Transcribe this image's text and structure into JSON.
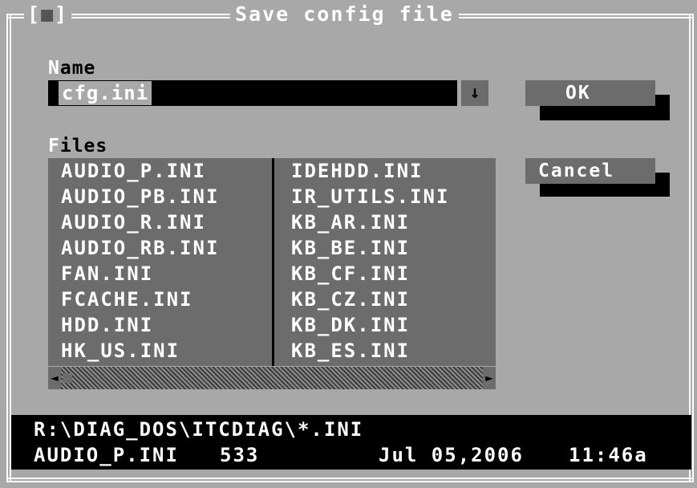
{
  "window": {
    "title": "Save config file",
    "close_glyph_left": "[",
    "close_glyph_mark": "■",
    "close_glyph_right": "]"
  },
  "name_field": {
    "label_hot": "N",
    "label_rest": "ame",
    "value": "cfg.ini",
    "history_glyph": "↓"
  },
  "files": {
    "label_hot": "F",
    "label_rest": "iles",
    "column_1": [
      "AUDIO_P.INI",
      "AUDIO_PB.INI",
      "AUDIO_R.INI",
      "AUDIO_RB.INI",
      "FAN.INI",
      "FCACHE.INI",
      "HDD.INI",
      "HK_US.INI"
    ],
    "column_2": [
      "IDEHDD.INI",
      "IR_UTILS.INI",
      "KB_AR.INI",
      "KB_BE.INI",
      "KB_CF.INI",
      "KB_CZ.INI",
      "KB_DK.INI",
      "KB_ES.INI"
    ],
    "scroll_left_glyph": "◄",
    "scroll_right_glyph": "►"
  },
  "buttons": {
    "ok": "OK",
    "cancel": "Cancel"
  },
  "info": {
    "path": "R:\\DIAG_DOS\\ITCDIAG\\*.INI",
    "file_name": "AUDIO_P.INI",
    "file_size": "533",
    "file_date": "Jul 05,2006",
    "file_time": "11:46a"
  },
  "colors": {
    "dialog_bg": "#a8a8a8",
    "field_bg": "#000000",
    "list_bg": "#6c6c6c",
    "text_white": "#ffffff"
  }
}
